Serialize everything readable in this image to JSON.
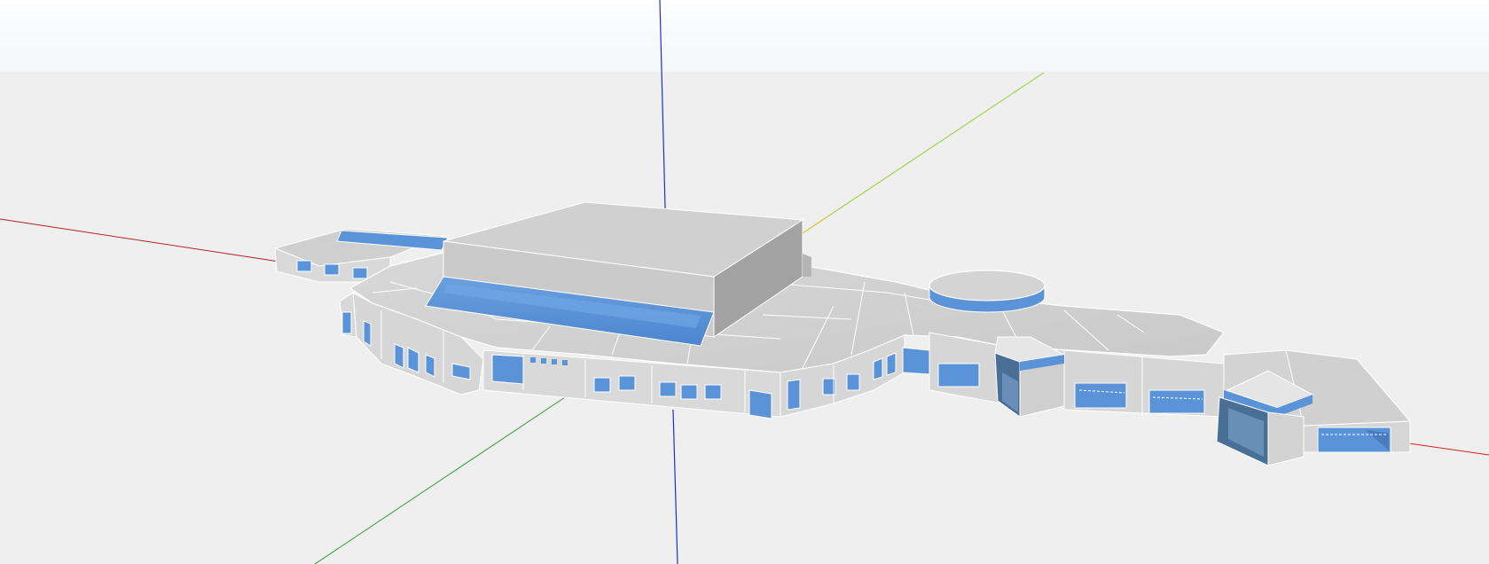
{
  "viewport": {
    "background_sky": "#f7fafd",
    "background_ground": "#efefef",
    "show_axes": true
  },
  "axes": {
    "x_color": "#b22222",
    "y_color": "#2e9b2e",
    "y_far_color": "#9acd32",
    "z_color": "#1f2fcf"
  },
  "model": {
    "type": "building-3d-model",
    "wall_color": "#d6d6d6",
    "roof_color": "#cfcfcf",
    "shadow_color": "#9a9a9a",
    "glazing_color": "#5b93d9",
    "glazing_dark_color": "#4a6f97"
  }
}
